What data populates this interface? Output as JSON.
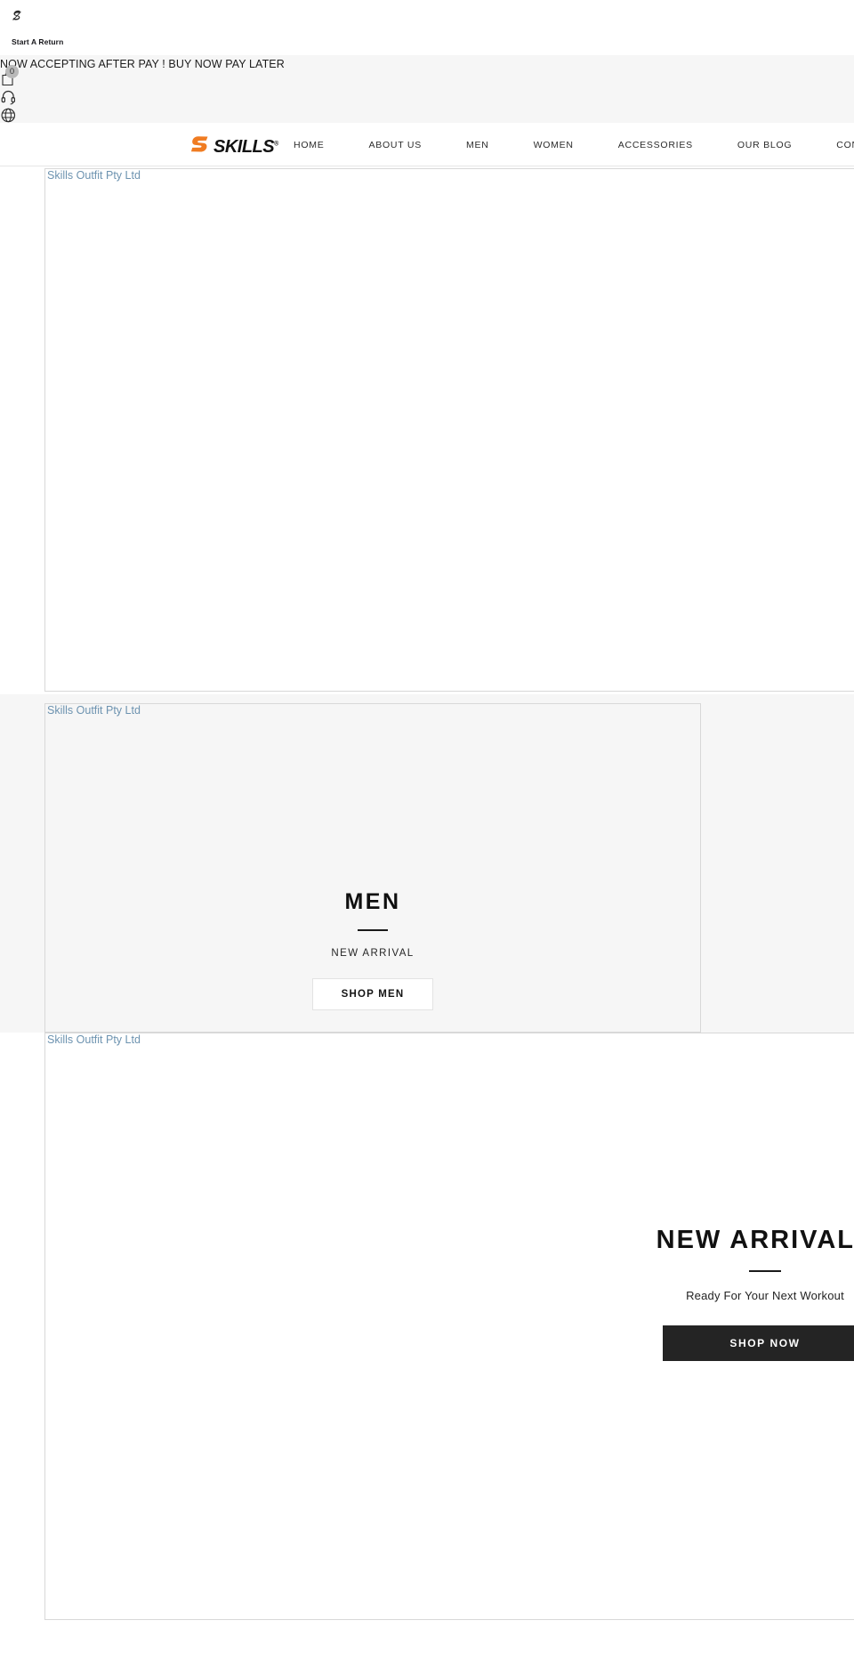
{
  "top_strip": {
    "logo_icon": "skills-s-mark-icon",
    "start_return_label": "Start A Return"
  },
  "promo_bar": {
    "message": "NOW ACCEPTING AFTER PAY ! BUY NOW PAY LATER",
    "icons": [
      {
        "name": "shopping-bag-icon",
        "badge": "0"
      },
      {
        "name": "headset-support-icon",
        "badge": ""
      },
      {
        "name": "globe-language-icon",
        "badge": ""
      }
    ],
    "background": "#f6f6f6"
  },
  "header": {
    "brand": {
      "mark_icon": "skills-lightning-s-icon",
      "word": "SKILLS",
      "registered": "®",
      "accent_color": "#f07c22"
    },
    "nav": [
      {
        "label": "HOME"
      },
      {
        "label": "ABOUT US"
      },
      {
        "label": "MEN"
      },
      {
        "label": "WOMEN"
      },
      {
        "label": "ACCESSORIES"
      },
      {
        "label": "OUR BLOG"
      },
      {
        "label": "CONTACT US"
      }
    ]
  },
  "hero": {
    "image_alt": "Skills Outfit Pty Ltd"
  },
  "men_section": {
    "image_alt": "Skills Outfit Pty Ltd",
    "title": "MEN",
    "subtitle": "NEW ARRIVAL",
    "button_label": "SHOP MEN"
  },
  "arrivals_section": {
    "image_alt": "Skills Outfit Pty Ltd",
    "title": "NEW ARRIVALS",
    "subtitle": "Ready For Your Next Workout",
    "button_label": "SHOP NOW"
  }
}
